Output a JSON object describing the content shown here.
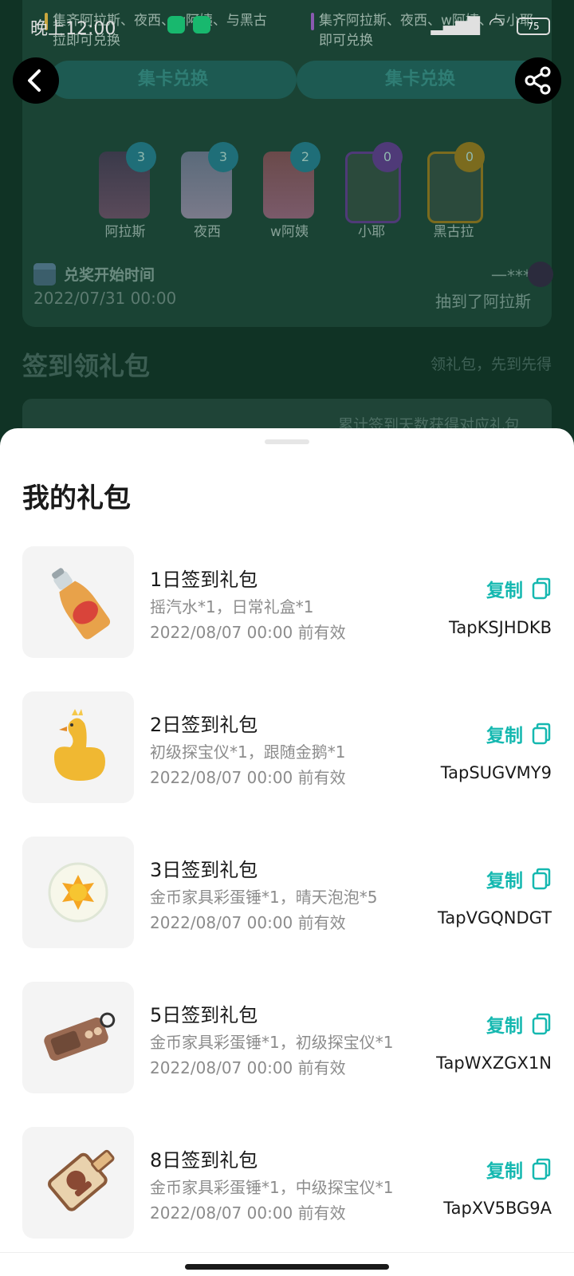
{
  "status_bar": {
    "time": "晚上12:00",
    "battery": "75"
  },
  "background": {
    "collect_left": {
      "desc": "集齐阿拉斯、夜西、w阿姨、与黑古拉即可兑换",
      "button": "集卡兑换"
    },
    "collect_right": {
      "desc": "集齐阿拉斯、夜西、w阿姨、与小耶即可兑换",
      "button": "集卡兑换"
    },
    "characters": [
      {
        "name": "阿拉斯",
        "count": "3",
        "color": "#1f6e78"
      },
      {
        "name": "夜西",
        "count": "3",
        "color": "#1f6e78"
      },
      {
        "name": "w阿姨",
        "count": "2",
        "color": "#1f6e78"
      },
      {
        "name": "小耶",
        "count": "0",
        "color": "#4f3a78"
      },
      {
        "name": "黑古拉",
        "count": "0",
        "color": "#7b6b1e"
      }
    ],
    "redeem_time_label": "兑奖开始时间",
    "redeem_time_value": "2022/07/31 00:00",
    "winner_name": "一***",
    "winner_text": "抽到了阿拉斯",
    "checkin_title": "签到领礼包",
    "checkin_subtitle": "领礼包，先到先得",
    "checkin_hint": "累计签到天数获得对应礼包"
  },
  "sheet": {
    "title": "我的礼包",
    "copy_label": "复制",
    "gifts": [
      {
        "name": "1日签到礼包",
        "items": "摇汽水*1，日常礼盒*1",
        "expire": "2022/08/07 00:00 前有效",
        "code": "TapKSJHDKB",
        "icon": "soda-bottle-icon"
      },
      {
        "name": "2日签到礼包",
        "items": "初级探宝仪*1，跟随金鹅*1",
        "expire": "2022/08/07 00:00 前有效",
        "code": "TapSUGVMY9",
        "icon": "golden-goose-icon"
      },
      {
        "name": "3日签到礼包",
        "items": "金币家具彩蛋锤*1，晴天泡泡*5",
        "expire": "2022/08/07 00:00 前有效",
        "code": "TapVGQNDGT",
        "icon": "sun-bubble-icon"
      },
      {
        "name": "5日签到礼包",
        "items": "金币家具彩蛋锤*1，初级探宝仪*1",
        "expire": "2022/08/07 00:00 前有效",
        "code": "TapWXZGX1N",
        "icon": "treasure-detector-icon"
      },
      {
        "name": "8日签到礼包",
        "items": "金币家具彩蛋锤*1，中级探宝仪*1",
        "expire": "2022/08/07 00:00 前有效",
        "code": "TapXV5BG9A",
        "icon": "advanced-detector-icon"
      }
    ]
  },
  "colors": {
    "accent": "#15b8b0",
    "background_dim": "#103325"
  }
}
